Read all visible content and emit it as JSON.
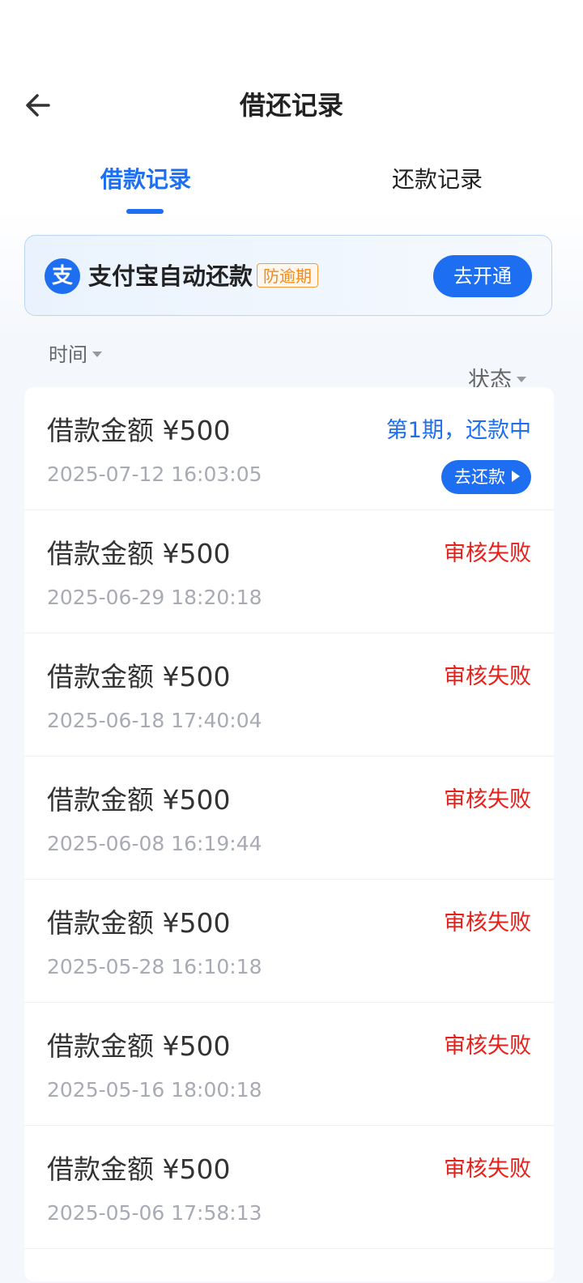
{
  "header": {
    "title": "借还记录",
    "back_icon": "arrow-left-icon"
  },
  "tabs": [
    {
      "label": "借款记录",
      "active": true
    },
    {
      "label": "还款记录",
      "active": false
    }
  ],
  "alipay_banner": {
    "logo_icon": "alipay-icon",
    "logo_glyph": "支",
    "text": "支付宝自动还款",
    "tag": "防逾期",
    "button_label": "去开通"
  },
  "filters": {
    "time_label": "时间",
    "status_label": "状态"
  },
  "records": [
    {
      "amount": "借款金额 ¥500",
      "date": "2025-07-12 16:03:05",
      "status": "第1期，还款中",
      "status_color": "#1d6ef0",
      "action": "去还款"
    },
    {
      "amount": "借款金额 ¥500",
      "date": "2025-06-29 18:20:18",
      "status": "审核失败",
      "status_color": "#e8201b"
    },
    {
      "amount": "借款金额 ¥500",
      "date": "2025-06-18 17:40:04",
      "status": "审核失败",
      "status_color": "#e8201b"
    },
    {
      "amount": "借款金额 ¥500",
      "date": "2025-06-08 16:19:44",
      "status": "审核失败",
      "status_color": "#e8201b"
    },
    {
      "amount": "借款金额 ¥500",
      "date": "2025-05-28 16:10:18",
      "status": "审核失败",
      "status_color": "#e8201b"
    },
    {
      "amount": "借款金额 ¥500",
      "date": "2025-05-16 18:00:18",
      "status": "审核失败",
      "status_color": "#e8201b"
    },
    {
      "amount": "借款金额 ¥500",
      "date": "2025-05-06 17:58:13",
      "status": "审核失败",
      "status_color": "#e8201b"
    }
  ],
  "colors": {
    "accent": "#1d6ef0",
    "error": "#e8201b",
    "tag_orange": "#f08a1e"
  }
}
